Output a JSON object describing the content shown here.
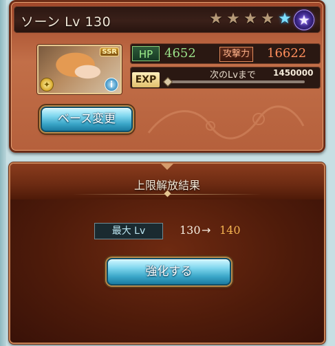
{
  "character": {
    "title": "ソーン Lv 130",
    "stars": [
      "star-filled",
      "star-filled",
      "star-filled",
      "star-filled",
      "star-blue",
      "star-purple-badge"
    ],
    "rarity_badge": "SSR",
    "hp_label": "HP",
    "hp_value": "4652",
    "attack_label": "攻撃力",
    "attack_value": "16622",
    "exp_label": "EXP",
    "exp_next_label": "次のLvまで",
    "exp_next_value": "1450000",
    "exp_progress": 0,
    "base_change_button": "ベース変更"
  },
  "dialog": {
    "title": "上限解放結果",
    "max_lv_label": "最大 Lv",
    "lv_from": "130",
    "lv_arrow": "→",
    "lv_to": "140",
    "enhance_button": "強化する"
  },
  "colors": {
    "hp": "#9be28a",
    "attack": "#ff8e5c",
    "lv_to": "#f4b350",
    "button": "#3aa6c8"
  }
}
